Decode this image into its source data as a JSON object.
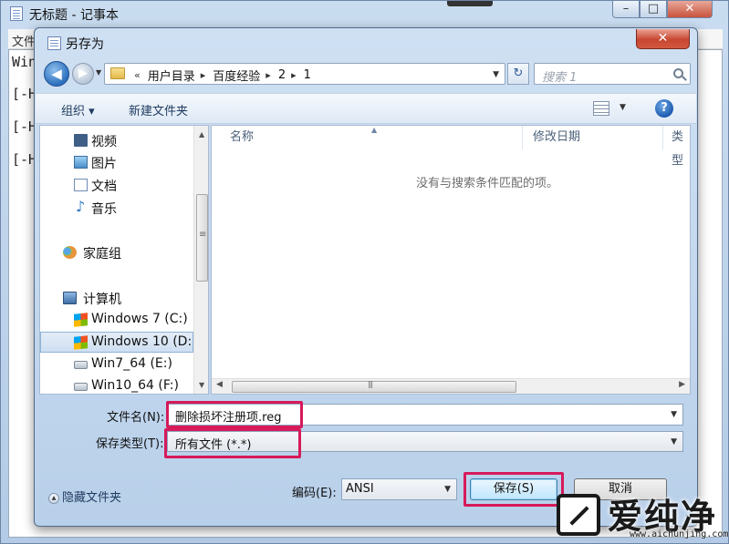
{
  "notepad": {
    "title": "无标题 - 记事本",
    "min_glyph": "–",
    "max_glyph": "□",
    "close_glyph": "✕",
    "menu_partial": "文件",
    "lines": [
      "Win",
      "[-H",
      "[-H",
      "[-H"
    ]
  },
  "dialog": {
    "title": "另存为",
    "close_glyph": "✕",
    "back_glyph": "◀",
    "fwd_glyph": "▶",
    "address": {
      "lead": "«",
      "parts": [
        "用户目录",
        "百度经验",
        "2",
        "1"
      ],
      "separator": "▸"
    },
    "refresh_glyph": "↻",
    "search_placeholder": "搜索 1",
    "toolbar": {
      "organize": "组织 ▾",
      "new_folder": "新建文件夹",
      "help": "?"
    },
    "nav": {
      "items": [
        {
          "label": "视频",
          "icon": "video-icon"
        },
        {
          "label": "图片",
          "icon": "pictures-icon"
        },
        {
          "label": "文档",
          "icon": "documents-icon"
        },
        {
          "label": "音乐",
          "icon": "music-icon"
        },
        {
          "label": "家庭组",
          "icon": "homegroup-icon"
        },
        {
          "label": "计算机",
          "icon": "computer-icon"
        },
        {
          "label": "Windows 7 (C:)",
          "icon": "windows-drive-icon"
        },
        {
          "label": "Windows 10 (D:",
          "icon": "windows-drive-icon",
          "selected": true
        },
        {
          "label": "Win7_64 (E:)",
          "icon": "drive-icon"
        },
        {
          "label": "Win10_64 (F:)",
          "icon": "drive-icon"
        }
      ]
    },
    "columns": {
      "name": "名称",
      "date": "修改日期",
      "type": "类型"
    },
    "empty_message": "没有与搜索条件匹配的项。",
    "filename_label": "文件名(N):",
    "filename_value": "删除损坏注册项.reg",
    "filetype_label": "保存类型(T):",
    "filetype_value": "所有文件 (*.*)",
    "hide_folders": "隐藏文件夹",
    "encoding_label": "编码(E):",
    "encoding_value": "ANSI",
    "save_button": "保存(S)",
    "cancel_button": "取消"
  },
  "watermark": {
    "text": "爱纯净",
    "url": "www.aichunjing.com"
  },
  "colors": {
    "highlight": "#d61a5a",
    "accent": "#2c6fbd"
  }
}
